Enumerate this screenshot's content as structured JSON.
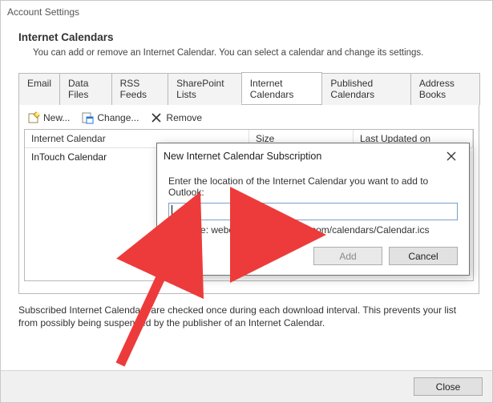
{
  "title": "Account Settings",
  "heading": "Internet Calendars",
  "subheading": "You can add or remove an Internet Calendar. You can select a calendar and change its settings.",
  "tabs": {
    "email": "Email",
    "data": "Data Files",
    "rss": "RSS Feeds",
    "sp": "SharePoint Lists",
    "ical": "Internet Calendars",
    "pub": "Published Calendars",
    "ab": "Address Books"
  },
  "toolbar": {
    "new_label": "New...",
    "change_label": "Change...",
    "remove_label": "Remove"
  },
  "table": {
    "col1": "Internet Calendar",
    "col2": "Size",
    "col3": "Last Updated on",
    "rows": [
      "InTouch Calendar"
    ]
  },
  "note": "Subscribed Internet Calendars are checked once during each download interval. This prevents your list from possibly being suspended by the publisher of an Internet Calendar.",
  "close_label": "Close",
  "dialog": {
    "title": "New Internet Calendar Subscription",
    "prompt": "Enter the location of the Internet Calendar you want to add to Outlook:",
    "value": "",
    "example": "Example: webcal://www.example.com/calendars/Calendar.ics",
    "add": "Add",
    "cancel": "Cancel"
  }
}
